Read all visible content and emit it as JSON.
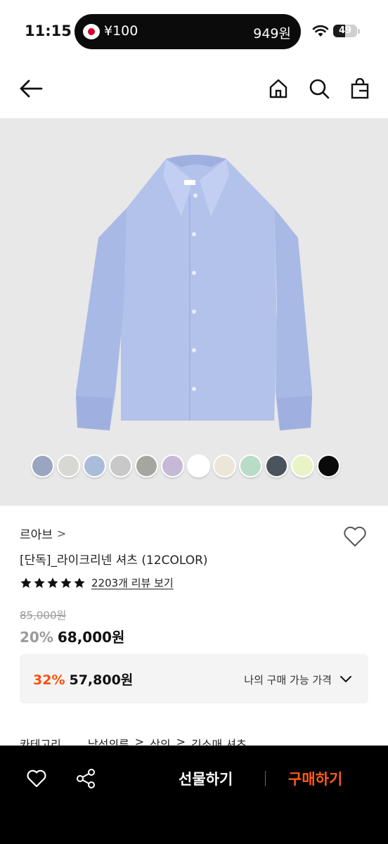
{
  "status_bar": {
    "time": "11:15",
    "currency_left": "¥100",
    "currency_right": "949원",
    "battery": "49",
    "battery_level": 0.49
  },
  "nav": {
    "icons": [
      "back-arrow-icon",
      "home-icon",
      "search-icon",
      "shopping-bag-icon"
    ]
  },
  "product": {
    "image_subject": "light blue long-sleeve shirt",
    "swatch_colors": [
      "#9aa5c2",
      "#d7d7d3",
      "#a9bcd9",
      "#c8c8c8",
      "#a5a5a2",
      "#c6b9d8",
      "#ffffff",
      "#ece6d8",
      "#b9dcc8",
      "#4b535c",
      "#eaf3c6",
      "#0a0a0a"
    ],
    "brand": "르아브",
    "brand_chevron": ">",
    "title": "[단독]_라이크리넨 셔츠 (12COLOR)",
    "rating": 5,
    "review_link": "2203개 리뷰 보기",
    "original_price": "85,000원",
    "discount_rate": "20%",
    "sale_price": "68,000원"
  },
  "my_price": {
    "discount_rate": "32%",
    "price": "57,800원",
    "label": "나의 구매 가능 가격",
    "accent": "#ff4d0d"
  },
  "category": {
    "label": "카테고리",
    "path": [
      "남성의류",
      ">",
      "상의",
      ">",
      "긴소매 셔츠"
    ]
  },
  "bottom_bar": {
    "gift_label": "선물하기",
    "buy_label": "구매하기",
    "buy_color": "#ff5b1a"
  }
}
